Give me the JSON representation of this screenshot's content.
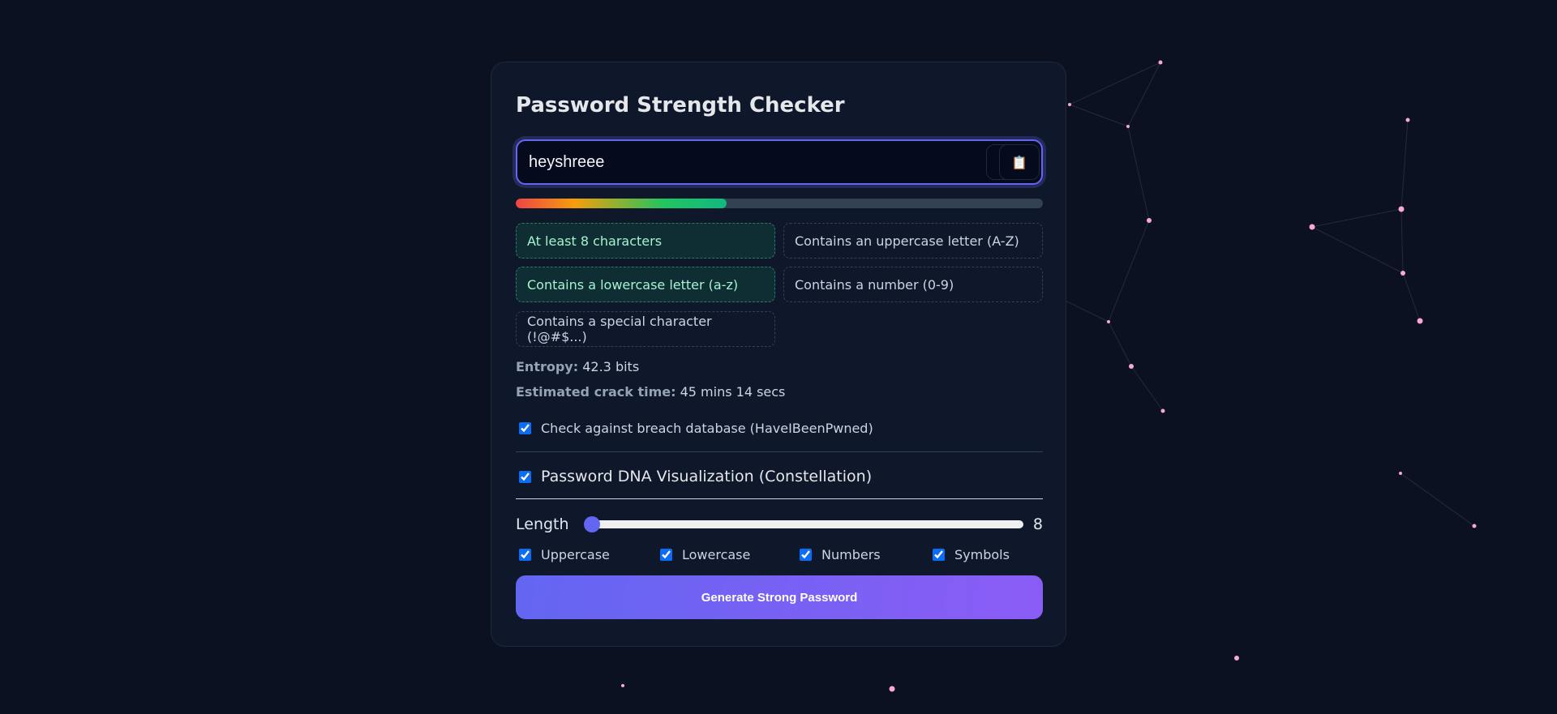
{
  "title": "Password Strength Checker",
  "password": {
    "value": "heyshreee",
    "show_icon": "eye-icon",
    "copy_icon": "clipboard-icon"
  },
  "strength": {
    "fraction": 0.4
  },
  "requirements": [
    {
      "label": "At least 8 characters",
      "met": true
    },
    {
      "label": "Contains an uppercase letter (A-Z)",
      "met": false
    },
    {
      "label": "Contains a lowercase letter (a-z)",
      "met": true
    },
    {
      "label": "Contains a number (0-9)",
      "met": false
    },
    {
      "label": "Contains a special character (!@#$...)",
      "met": false
    }
  ],
  "entropy": {
    "label": "Entropy:",
    "value": "42.3 bits"
  },
  "crack": {
    "label": "Estimated crack time:",
    "value": "45 mins 14 secs"
  },
  "breach_check": {
    "label": "Check against breach database (HaveIBeenPwned)",
    "checked": true
  },
  "dna": {
    "label": "Password DNA Visualization (Constellation)",
    "checked": true
  },
  "generator": {
    "length_label": "Length",
    "length": "8",
    "length_min": 8,
    "length_max": 64,
    "options": [
      {
        "label": "Uppercase"
      },
      {
        "label": "Lowercase"
      },
      {
        "label": "Numbers"
      },
      {
        "label": "Symbols"
      }
    ],
    "button": "Generate Strong Password"
  },
  "colors": {
    "accent": "#6366f1",
    "particle": "#f9a8d4",
    "met_bg": "#0f2e33"
  }
}
